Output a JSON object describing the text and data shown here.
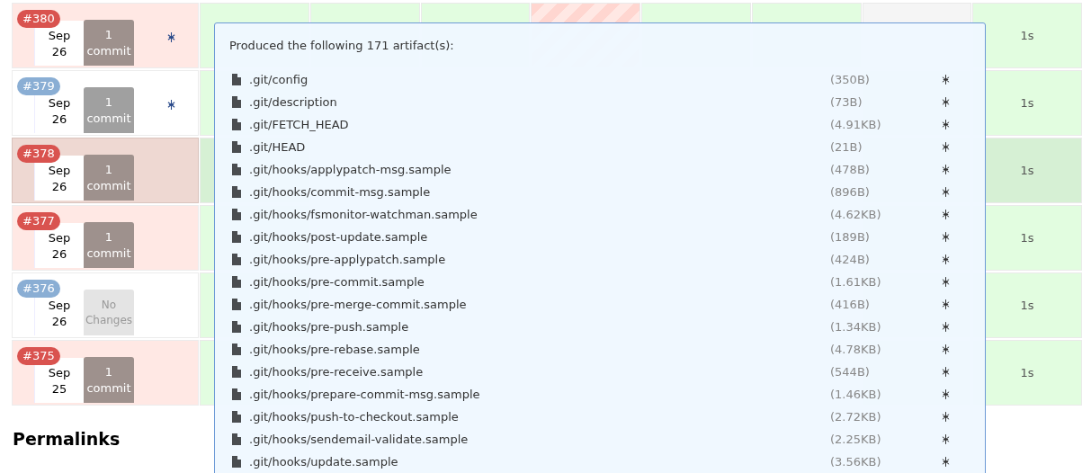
{
  "builds": [
    {
      "number": "#380",
      "color": "#d9534f",
      "failed": true,
      "selected": false,
      "month": "Sep",
      "day": "26",
      "no_changes": false,
      "changes": [
        "1",
        "commit"
      ],
      "fingerprint": true,
      "stages": [
        {
          "kind": "passed"
        },
        {
          "kind": "passed"
        },
        {
          "kind": "passed"
        },
        {
          "kind": "failed"
        },
        {
          "kind": "passed"
        },
        {
          "kind": "passed"
        },
        {
          "kind": "skipped"
        },
        {
          "kind": "passed"
        }
      ],
      "duration": "1s"
    },
    {
      "number": "#379",
      "color": "#8aaed4",
      "failed": false,
      "selected": false,
      "month": "Sep",
      "day": "26",
      "no_changes": false,
      "changes": [
        "1",
        "commit"
      ],
      "fingerprint": true,
      "duration": "1s"
    },
    {
      "number": "#378",
      "color": "#d9534f",
      "failed": true,
      "selected": true,
      "month": "Sep",
      "day": "26",
      "no_changes": false,
      "changes": [
        "1",
        "commit"
      ],
      "fingerprint": false,
      "duration": "1s"
    },
    {
      "number": "#377",
      "color": "#d9534f",
      "failed": true,
      "selected": false,
      "month": "Sep",
      "day": "26",
      "no_changes": false,
      "changes": [
        "1",
        "commit"
      ],
      "fingerprint": false,
      "duration": "1s"
    },
    {
      "number": "#376",
      "color": "#8aaed4",
      "failed": false,
      "selected": false,
      "month": "Sep",
      "day": "26",
      "no_changes": true,
      "changes": [
        "No",
        "Changes"
      ],
      "fingerprint": false,
      "duration": "1s"
    },
    {
      "number": "#375",
      "color": "#d9534f",
      "failed": true,
      "selected": false,
      "month": "Sep",
      "day": "25",
      "no_changes": false,
      "changes": [
        "1",
        "commit"
      ],
      "fingerprint": false,
      "duration": "1s"
    }
  ],
  "permalinks": {
    "heading": "Permalinks"
  },
  "artifacts_popup": {
    "title": "Produced the following 171 artifact(s):",
    "artifacts": [
      {
        "name": ".git/config",
        "size": "(350B)"
      },
      {
        "name": ".git/description",
        "size": "(73B)"
      },
      {
        "name": ".git/FETCH_HEAD",
        "size": "(4.91KB)"
      },
      {
        "name": ".git/HEAD",
        "size": "(21B)"
      },
      {
        "name": ".git/hooks/applypatch-msg.sample",
        "size": "(478B)"
      },
      {
        "name": ".git/hooks/commit-msg.sample",
        "size": "(896B)"
      },
      {
        "name": ".git/hooks/fsmonitor-watchman.sample",
        "size": "(4.62KB)"
      },
      {
        "name": ".git/hooks/post-update.sample",
        "size": "(189B)"
      },
      {
        "name": ".git/hooks/pre-applypatch.sample",
        "size": "(424B)"
      },
      {
        "name": ".git/hooks/pre-commit.sample",
        "size": "(1.61KB)"
      },
      {
        "name": ".git/hooks/pre-merge-commit.sample",
        "size": "(416B)"
      },
      {
        "name": ".git/hooks/pre-push.sample",
        "size": "(1.34KB)"
      },
      {
        "name": ".git/hooks/pre-rebase.sample",
        "size": "(4.78KB)"
      },
      {
        "name": ".git/hooks/pre-receive.sample",
        "size": "(544B)"
      },
      {
        "name": ".git/hooks/prepare-commit-msg.sample",
        "size": "(1.46KB)"
      },
      {
        "name": ".git/hooks/push-to-checkout.sample",
        "size": "(2.72KB)"
      },
      {
        "name": ".git/hooks/sendemail-validate.sample",
        "size": "(2.25KB)"
      },
      {
        "name": ".git/hooks/update.sample",
        "size": "(3.56KB)"
      }
    ]
  }
}
